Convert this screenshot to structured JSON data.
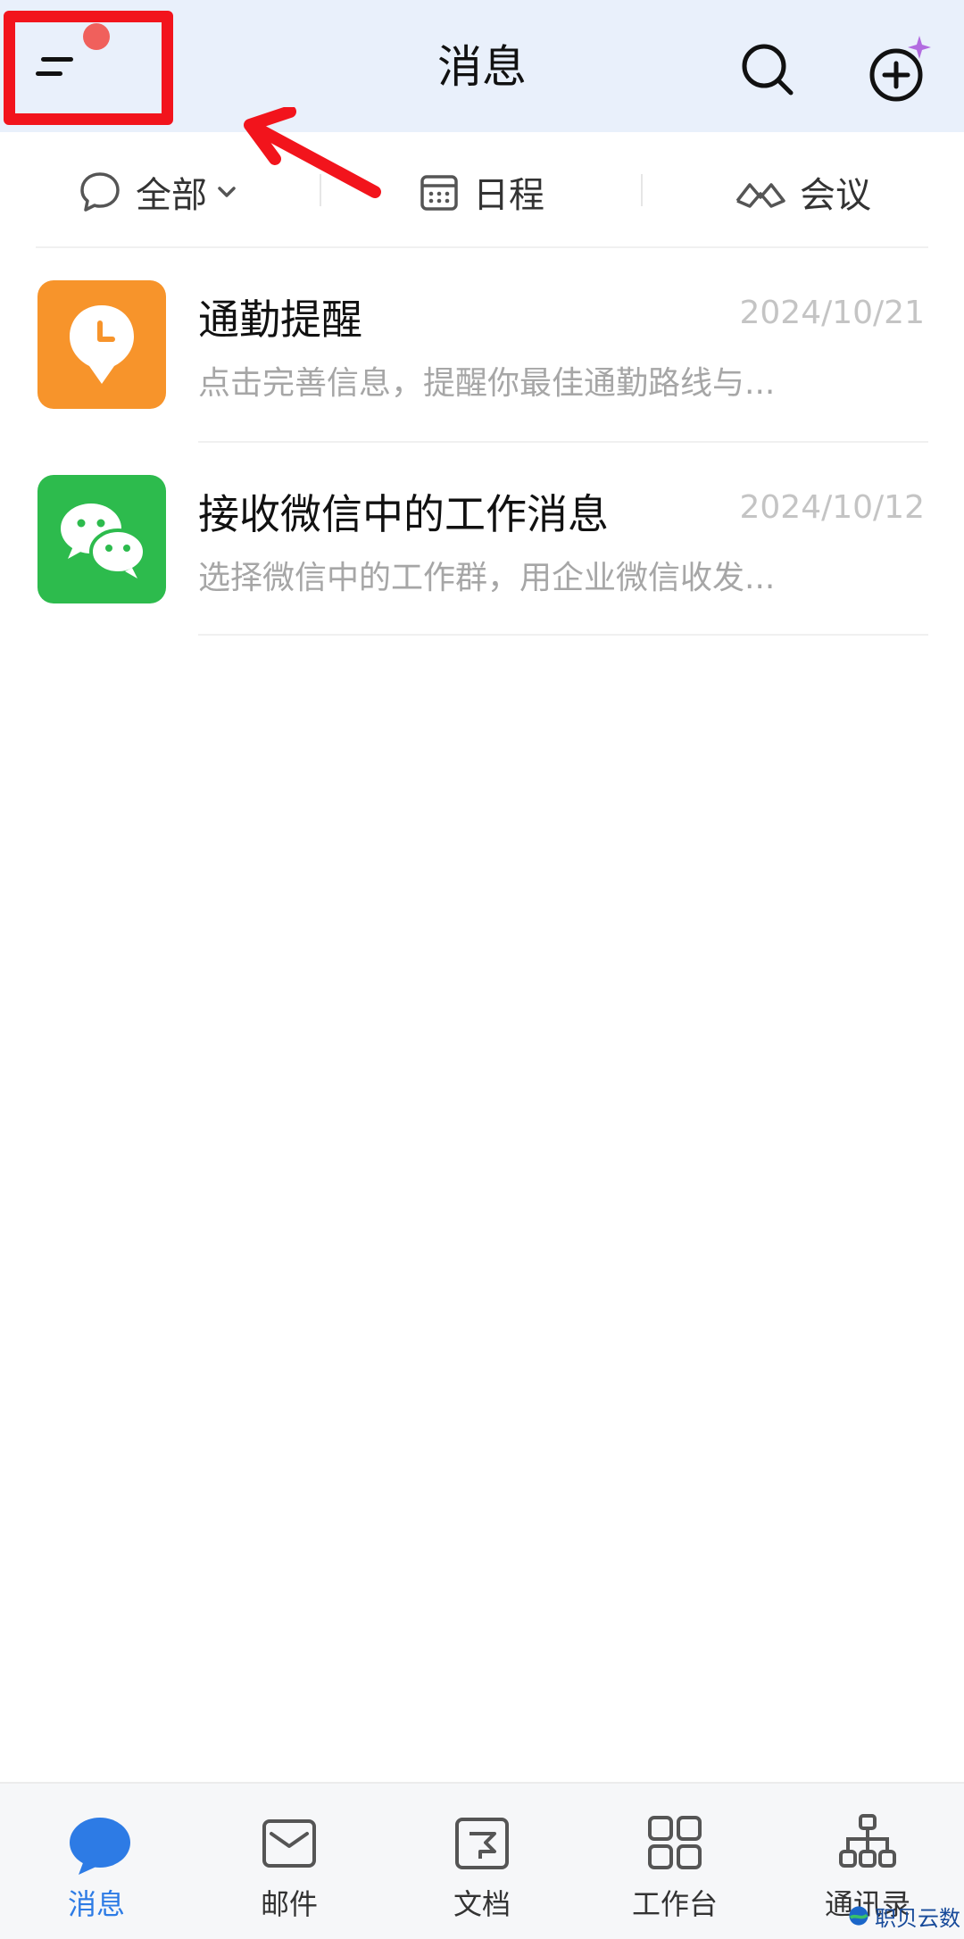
{
  "header": {
    "title": "消息"
  },
  "filters": [
    {
      "label": "全部",
      "icon": "chat-bubble-icon"
    },
    {
      "label": "日程",
      "icon": "calendar-icon"
    },
    {
      "label": "会议",
      "icon": "meeting-icon"
    }
  ],
  "conversations": [
    {
      "name": "通勤提醒",
      "date": "2024/10/21",
      "preview": "点击完善信息，提醒你最佳通勤路线与...",
      "icon": "clock-pin-icon",
      "color": "#f7942b"
    },
    {
      "name": "接收微信中的工作消息",
      "date": "2024/10/12",
      "preview": "选择微信中的工作群，用企业微信收发...",
      "icon": "wechat-icon",
      "color": "#2dbb4d"
    }
  ],
  "tabs": [
    {
      "label": "消息",
      "icon": "message-bubble-icon"
    },
    {
      "label": "邮件",
      "icon": "mail-icon"
    },
    {
      "label": "文档",
      "icon": "document-icon"
    },
    {
      "label": "工作台",
      "icon": "grid-icon"
    },
    {
      "label": "通讯录",
      "icon": "org-chart-icon"
    }
  ],
  "watermark": {
    "text": "职贝云数"
  },
  "colors": {
    "header_bg": "#e9f0fb",
    "accent": "#2d7be5",
    "highlight": "#f2141c",
    "badge": "#f0605c"
  }
}
